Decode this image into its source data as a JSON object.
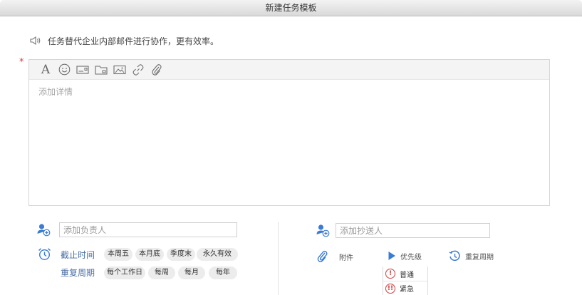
{
  "window": {
    "title": "新建任务模板"
  },
  "hint": {
    "text": "任务替代企业内部邮件进行协作，更有效率。"
  },
  "required_mark": "*",
  "editor": {
    "toolbar_icons": [
      "font-icon",
      "emoji-icon",
      "card-icon",
      "folder-icon",
      "image-icon",
      "link-icon",
      "attachment-icon"
    ],
    "font_glyph": "A",
    "placeholder": "添加详情"
  },
  "assignee": {
    "placeholder": "添加负责人"
  },
  "cc": {
    "placeholder": "添加抄送人"
  },
  "deadline": {
    "label": "截止时间",
    "options": [
      "本周五",
      "本月底",
      "季度末",
      "永久有效"
    ]
  },
  "repeat": {
    "label": "重复周期",
    "options": [
      "每个工作日",
      "每周",
      "每月",
      "每年"
    ]
  },
  "actions": {
    "attachment": "附件",
    "priority": "优先级",
    "repeat": "重复周期"
  },
  "priority_menu": {
    "items": [
      {
        "icon": "!",
        "label": "普通"
      },
      {
        "icon": "!!",
        "label": "紧急"
      }
    ]
  },
  "colors": {
    "accent": "#3a7bd5",
    "required": "#e0413b",
    "link_text": "#4a6fa5",
    "urgent": "#d23b3b"
  }
}
